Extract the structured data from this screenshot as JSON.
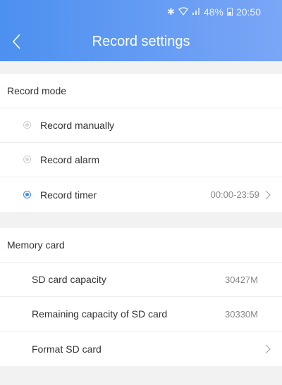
{
  "status_bar": {
    "bluetooth_icon": "bluetooth-icon",
    "wifi_icon": "wifi-icon",
    "signal_icon": "signal-icon",
    "battery_percent": "48%",
    "battery_icon": "battery-icon",
    "time": "20:50"
  },
  "header": {
    "title": "Record settings",
    "back_icon": "chevron-left-icon",
    "colors": {
      "gradient_start": "#4c90f0",
      "gradient_end": "#7aa6f6"
    }
  },
  "record_mode": {
    "heading": "Record mode",
    "options": [
      {
        "label": "Record manually",
        "selected": false
      },
      {
        "label": "Record alarm",
        "selected": false
      },
      {
        "label": "Record timer",
        "selected": true,
        "value": "00:00-23:59"
      }
    ]
  },
  "memory_card": {
    "heading": "Memory card",
    "capacity_label": "SD card capacity",
    "capacity_value": "30427M",
    "remaining_label": "Remaining capacity of SD card",
    "remaining_value": "30330M",
    "format_label": "Format SD card"
  },
  "colors": {
    "accent": "#3f87f5",
    "background": "#f2f2f2"
  }
}
